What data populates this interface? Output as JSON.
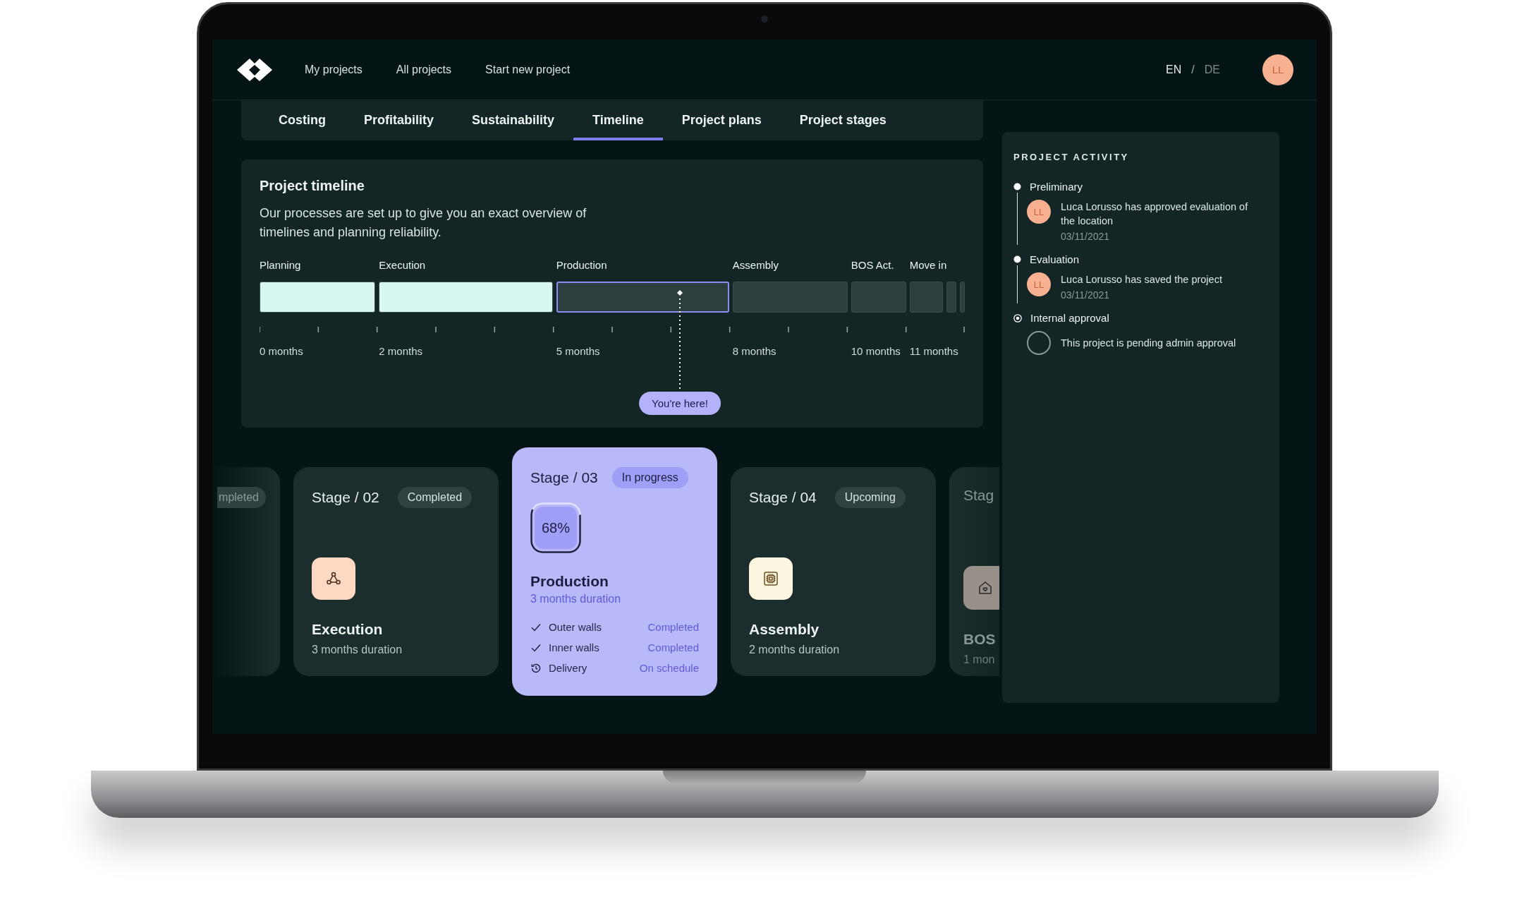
{
  "nav": {
    "links": [
      {
        "label": "My projects"
      },
      {
        "label": "All projects"
      },
      {
        "label": "Start new project"
      }
    ],
    "languages": [
      {
        "label": "EN",
        "selected": true
      },
      {
        "label": "DE",
        "selected": false
      }
    ],
    "separator": "/",
    "avatar": "LL"
  },
  "tabs": [
    {
      "label": "Costing",
      "selected": false
    },
    {
      "label": "Profitability",
      "selected": false
    },
    {
      "label": "Sustainability",
      "selected": false
    },
    {
      "label": "Timeline",
      "selected": true
    },
    {
      "label": "Project plans",
      "selected": false
    },
    {
      "label": "Project stages",
      "selected": false
    }
  ],
  "timeline": {
    "title": "Project timeline",
    "description": "Our processes are set up to give you an exact overview of timelines and planning reliability.",
    "phases": [
      {
        "label": "Planning",
        "start_label": "0 months",
        "completed": true,
        "current": false
      },
      {
        "label": "Execution",
        "start_label": "2 months",
        "completed": true,
        "current": false
      },
      {
        "label": "Production",
        "start_label": "5 months",
        "completed": false,
        "current": true
      },
      {
        "label": "Assembly",
        "start_label": "8 months",
        "completed": false,
        "current": false
      },
      {
        "label": "BOS Act.",
        "start_label": "10 months",
        "completed": false,
        "current": false
      },
      {
        "label": "Move in",
        "start_label": "11 months",
        "completed": false,
        "current": false
      },
      {
        "completed": false,
        "current": false
      },
      {
        "completed": false,
        "current": false
      }
    ],
    "marker": {
      "label": "You're here!",
      "level": 0.596
    }
  },
  "stages": [
    {
      "kind": "partial-left",
      "badge": "mpleted"
    },
    {
      "kind": "stage",
      "label": "Stage / 02",
      "badge": "Completed",
      "color": "#fdd9c4",
      "title": "Execution",
      "duration": "3 months duration"
    },
    {
      "kind": "active",
      "label": "Stage / 03",
      "badge": "In progress",
      "progress": "68%",
      "title": "Production",
      "duration": "3 months duration",
      "tasks": [
        {
          "kind": "done",
          "label": "Outer walls",
          "status": "Completed"
        },
        {
          "kind": "done",
          "label": "Inner walls",
          "status": "Completed"
        },
        {
          "kind": "scheduled",
          "label": "Delivery",
          "status": "On schedule"
        }
      ]
    },
    {
      "kind": "stage",
      "label": "Stage / 04",
      "badge": "Upcoming",
      "color": "#fcf5e0",
      "title": "Assembly",
      "duration": "2 months duration"
    },
    {
      "kind": "partial-right",
      "label": "Stag",
      "color": "#9a908a",
      "title": "BOS",
      "duration": "1 mon"
    }
  ],
  "activity": {
    "title": "PROJECT ACTIVITY",
    "groups": [
      {
        "title": "Preliminary",
        "completed": true,
        "entries": [
          {
            "kind": "event",
            "avatar": "LL",
            "text": "Luca Lorusso has approved evaluation of the location",
            "date": "03/11/2021"
          }
        ]
      },
      {
        "title": "Evaluation",
        "completed": true,
        "entries": [
          {
            "kind": "event",
            "avatar": "LL",
            "text": "Luca Lorusso has saved the project",
            "date": "03/11/2021"
          }
        ]
      },
      {
        "title": "Internal approval",
        "completed": false,
        "entries": [
          {
            "kind": "pending",
            "text": "This project is pending admin approval"
          }
        ]
      }
    ]
  }
}
